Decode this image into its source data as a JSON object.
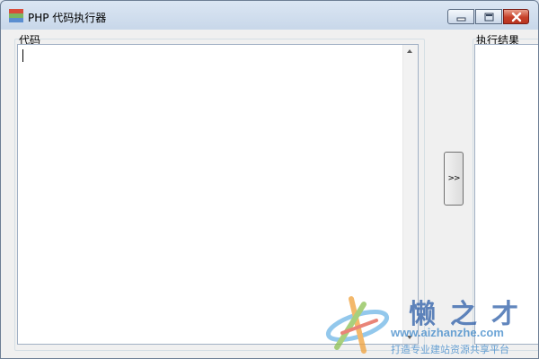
{
  "window": {
    "title": "PHP 代码执行器",
    "controls": {
      "minimize_icon": "minimize-icon",
      "maximize_icon": "maximize-icon",
      "close_icon": "close-icon"
    }
  },
  "code_panel": {
    "label": "代码",
    "value": ""
  },
  "run_button": {
    "label": ">>"
  },
  "result_panel": {
    "label": "执行结果",
    "value": ""
  },
  "watermark": {
    "brand": "懒之才",
    "url": "www.aizhanzhe.com",
    "slogan": "打造专业建站资源共享平台"
  },
  "colors": {
    "close_button": "#c7412a",
    "title_bar": "#c9d8ea",
    "watermark_blue": "#2d5ea8"
  }
}
